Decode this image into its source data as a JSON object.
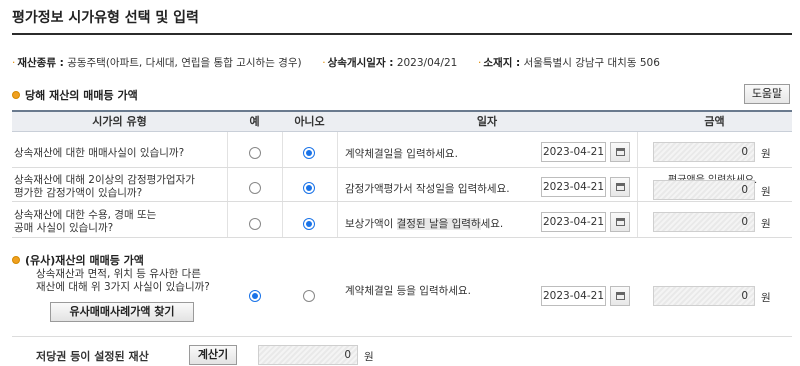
{
  "page": {
    "title": "평가정보 시가유형 선택 및 입력"
  },
  "info": {
    "asset_type_label": "재산종류 :",
    "asset_type_value": "공동주택(아파트, 다세대, 연립을 통합 고시하는 경우)",
    "start_date_label": "상속개시일자 :",
    "start_date_value": "2023/04/21",
    "location_label": "소재지 :",
    "location_value": "서울특별시 강남구 대치동 506"
  },
  "section1": {
    "title": "당해 재산의 매매등 가액",
    "help_label": "도움말"
  },
  "table": {
    "headers": [
      "시가의 유형",
      "예",
      "아니오",
      "일자",
      "금액"
    ],
    "rows": [
      {
        "question": "상속재산에 대한 매매사실이 있습니까?",
        "yes": false,
        "no": true,
        "date_prompt": "계약체결일을 입력하세요.",
        "date": "2023-04-21",
        "amount": "0",
        "unit": "원",
        "note": ""
      },
      {
        "question_l1": "상속재산에 대해 2이상의 감정평가업자가",
        "question_l2": "평가한 감정가액이 있습니까?",
        "yes": false,
        "no": true,
        "date_prompt": "감정가액평가서 작성일을 입력하세요.",
        "date": "2023-04-21",
        "amount": "0",
        "unit": "원",
        "note": "평균액을 입력하세요."
      },
      {
        "question_l1": "상속재산에 대한 수용, 경매 또는",
        "question_l2": "공매 사실이 있습니까?",
        "yes": false,
        "no": true,
        "date_prompt_a": "보상가액이 ",
        "date_prompt_b": "결정된 날을 입력하",
        "date_prompt_c": "세요.",
        "date": "2023-04-21",
        "amount": "0",
        "unit": "원",
        "note": ""
      }
    ]
  },
  "section2": {
    "title": "(유사)재산의 매매등 가액",
    "question_l1": "상속재산과 면적, 위치 등 유사한 다른",
    "question_l2": "재산에 대해 위 3가지 사실이 있습니까?",
    "yes": true,
    "no": false,
    "date_prompt": "계약체결일 등을 입력하세요.",
    "date": "2023-04-21",
    "amount": "0",
    "unit": "원",
    "find_button": "유사매매사례가액 찾기"
  },
  "mortgage": {
    "label": "저당권 등이 설정된 재산",
    "calc_button": "계산기",
    "amount": "0",
    "unit": "원"
  }
}
